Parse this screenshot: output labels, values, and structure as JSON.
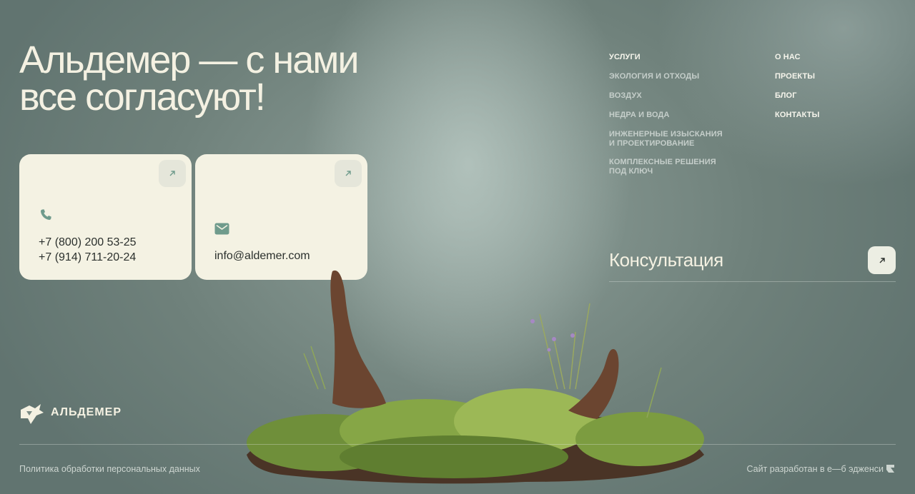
{
  "headline": {
    "line1": "Альдемер — с нами",
    "line2": "все согласуют!"
  },
  "contacts": {
    "phone1": "+7 (800) 200 53-25",
    "phone2": "+7 (914) 711-20-24",
    "email": "info@aldemer.com"
  },
  "menu": {
    "col1": [
      {
        "label": "Услуги"
      },
      {
        "label": "Экология и отходы"
      },
      {
        "label": "Воздух"
      },
      {
        "label": "Недра и вода"
      },
      {
        "label": "Инженерные изыскания и проектирование"
      },
      {
        "label": "Комплексные решения под ключ"
      }
    ],
    "col2": [
      {
        "label": "О нас"
      },
      {
        "label": "Проекты"
      },
      {
        "label": "Блог"
      },
      {
        "label": "Контакты"
      }
    ]
  },
  "consultation": {
    "label": "Консультация"
  },
  "logo": {
    "text": "АЛЬДЕМЕР"
  },
  "footer": {
    "policy": "Политика обработки персональных данных",
    "made_by": "Сайт разработан в е—б эдженси"
  },
  "colors": {
    "background": "#7a8b85",
    "card": "#f4f2e3",
    "text_light": "#f4f1e2",
    "accent_green": "#6f9b8c"
  },
  "icons": [
    "arrow-up-right-icon",
    "phone-icon",
    "mail-icon",
    "logo-icon",
    "agency-icon"
  ]
}
